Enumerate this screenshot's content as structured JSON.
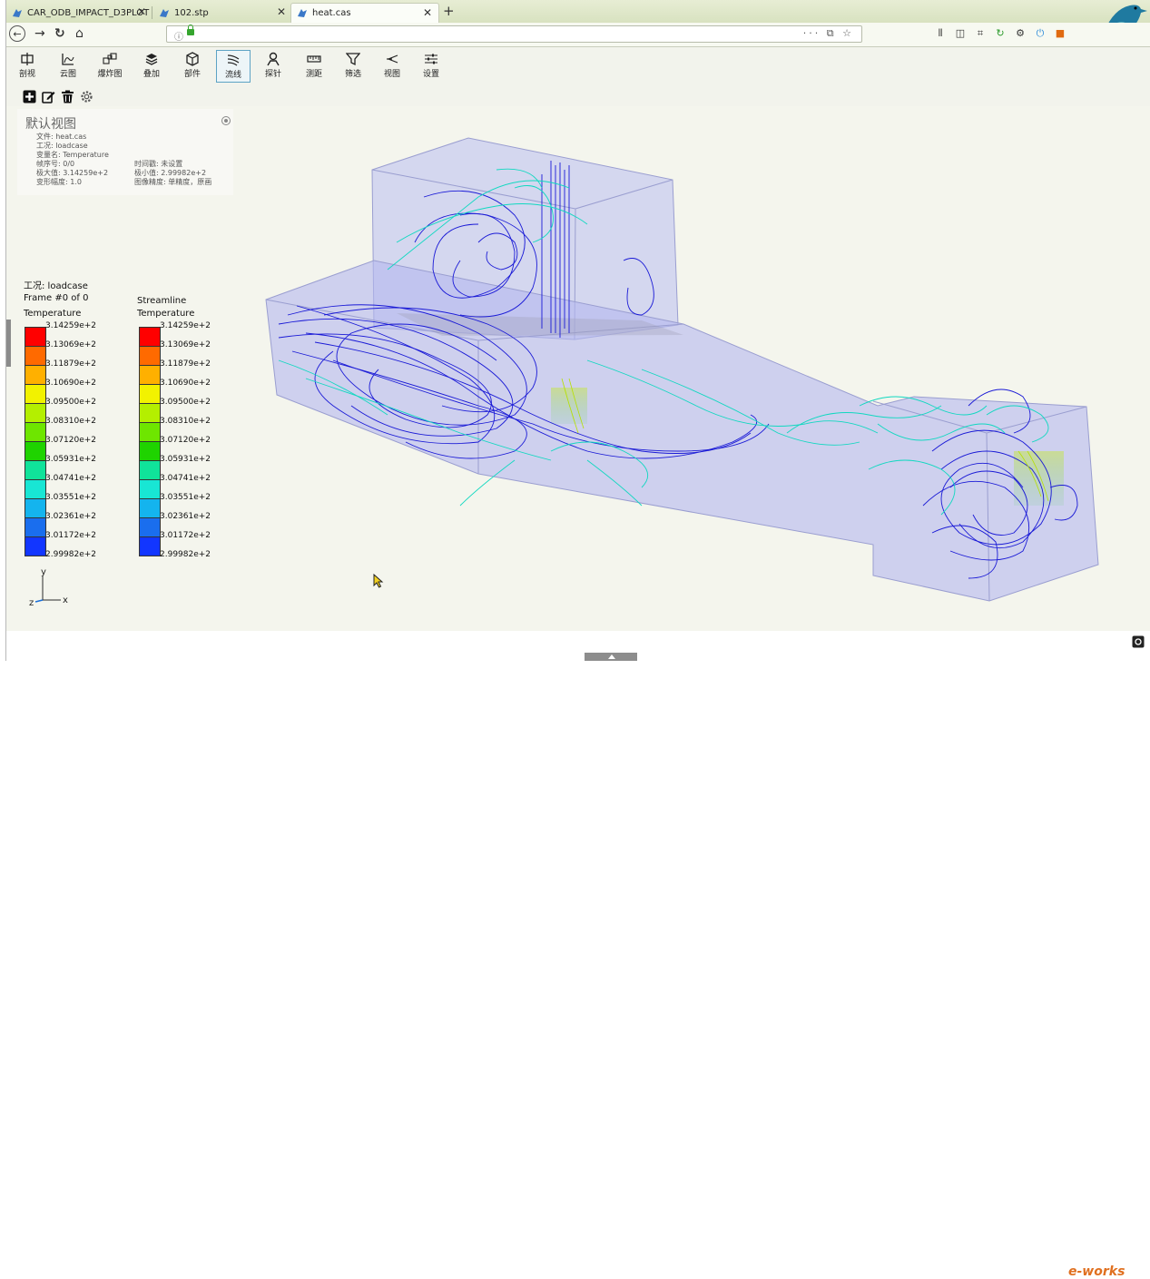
{
  "browser": {
    "tabs": [
      {
        "title": "CAR_ODB_IMPACT_D3PLOT"
      },
      {
        "title": "102.stp"
      },
      {
        "title": "heat.cas"
      }
    ],
    "tab_close": "✕",
    "new_tab": "+",
    "url_menu": "··· ⧉ ☆",
    "accent": "#3a78c8"
  },
  "toolbar": {
    "items": [
      {
        "label": "剖视",
        "icon": "section-icon"
      },
      {
        "label": "云图",
        "icon": "contour-icon"
      },
      {
        "label": "爆炸图",
        "icon": "explode-icon"
      },
      {
        "label": "叠加",
        "icon": "layers-icon"
      },
      {
        "label": "部件",
        "icon": "part-cube-icon"
      },
      {
        "label": "流线",
        "icon": "streamline-icon"
      },
      {
        "label": "探针",
        "icon": "probe-icon"
      },
      {
        "label": "测距",
        "icon": "measure-icon"
      },
      {
        "label": "筛选",
        "icon": "filter-icon"
      },
      {
        "label": "视图",
        "icon": "view-icon"
      },
      {
        "label": "设置",
        "icon": "settings-sliders-icon"
      }
    ],
    "active_index": 5
  },
  "info": {
    "view_title": "默认视图",
    "file": "文件: heat.cas",
    "loadcase": "工况: loadcase",
    "variable": "变量名: Temperature",
    "frame": "帧序号: 0/0",
    "max": "极大值: 3.14259e+2",
    "deform": "变形幅度: 1.0",
    "time_step": "时间戳: 未设置",
    "min": "极小值: 2.99982e+2",
    "precision": "图像精度: 单精度，原画"
  },
  "legend": {
    "loadcase": "工况: loadcase",
    "frame": "Frame #0 of 0",
    "left_var": "Temperature",
    "right_title": "Streamline",
    "right_var": "Temperature",
    "values": [
      "3.14259e+2",
      "3.13069e+2",
      "3.11879e+2",
      "3.10690e+2",
      "3.09500e+2",
      "3.08310e+2",
      "3.07120e+2",
      "3.05931e+2",
      "3.04741e+2",
      "3.03551e+2",
      "3.02361e+2",
      "3.01172e+2",
      "2.99982e+2"
    ],
    "colors": [
      "#ff0000",
      "#ff6a00",
      "#ffb000",
      "#f2f200",
      "#b4ef00",
      "#6ee600",
      "#1fd300",
      "#10e39a",
      "#18e6d4",
      "#14b4ee",
      "#1a6eee",
      "#1236ff"
    ]
  },
  "axes": {
    "y": "y",
    "z": "z",
    "x": "x"
  }
}
